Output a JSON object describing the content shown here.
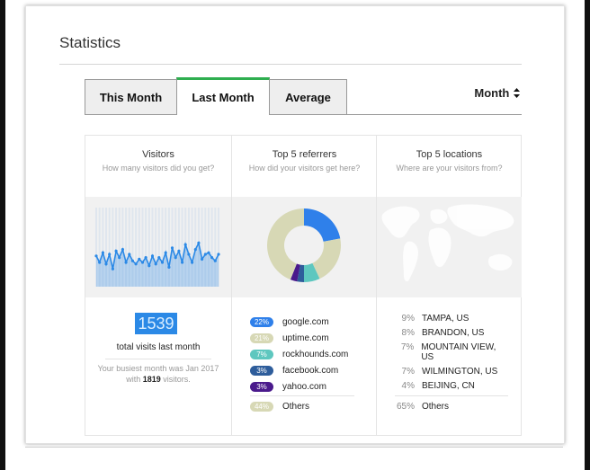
{
  "header": {
    "title": "Statistics"
  },
  "tabs": [
    {
      "label": "This Month",
      "active": false
    },
    {
      "label": "Last Month",
      "active": true
    },
    {
      "label": "Average",
      "active": false
    }
  ],
  "period_select": {
    "value": "Month",
    "icon": "updown-arrows-icon"
  },
  "visitors": {
    "title": "Visitors",
    "subtitle": "How many visitors did you get?",
    "total": "1539",
    "total_label": "total visits last month",
    "busiest_prefix": "Your busiest month was Jan 2017 with",
    "busiest_count": "1819",
    "busiest_suffix": "visitors.",
    "sparkline": [
      38,
      30,
      42,
      28,
      40,
      22,
      44,
      36,
      46,
      30,
      40,
      32,
      28,
      34,
      30,
      36,
      26,
      38,
      28,
      36,
      30,
      42,
      24,
      48,
      36,
      44,
      30,
      52,
      40,
      30,
      46,
      54,
      34,
      40,
      42,
      36,
      32,
      40
    ]
  },
  "referrers": {
    "title": "Top 5 referrers",
    "subtitle": "How did your visitors get here?",
    "items": [
      {
        "pct": "22%",
        "name": "google.com",
        "value": 22,
        "color": "#2f80ea",
        "text_color": "#ffffff"
      },
      {
        "pct": "21%",
        "name": "uptime.com",
        "value": 21,
        "color": "#d7d8b5",
        "text_color": "#ffffff"
      },
      {
        "pct": "7%",
        "name": "rockhounds.com",
        "value": 7,
        "color": "#5ec7bf",
        "text_color": "#ffffff"
      },
      {
        "pct": "3%",
        "name": "facebook.com",
        "value": 3,
        "color": "#2e5d9b",
        "text_color": "#ffffff"
      },
      {
        "pct": "3%",
        "name": "yahoo.com",
        "value": 3,
        "color": "#4a1a8c",
        "text_color": "#ffffff"
      }
    ],
    "others": {
      "pct": "44%",
      "name": "Others",
      "value": 44,
      "color": "#d7d8b5",
      "text_color": "#ffffff"
    }
  },
  "locations": {
    "title": "Top 5 locations",
    "subtitle": "Where are your visitors from?",
    "items": [
      {
        "pct": "9%",
        "name": "TAMPA, US"
      },
      {
        "pct": "8%",
        "name": "BRANDON, US"
      },
      {
        "pct": "7%",
        "name": "MOUNTAIN VIEW, US"
      },
      {
        "pct": "7%",
        "name": "WILMINGTON, US"
      },
      {
        "pct": "4%",
        "name": "BEIJING, CN"
      }
    ],
    "others": {
      "pct": "65%",
      "name": "Others"
    }
  },
  "colors": {
    "accent": "#2eae4f",
    "primary": "#2b89e6"
  }
}
